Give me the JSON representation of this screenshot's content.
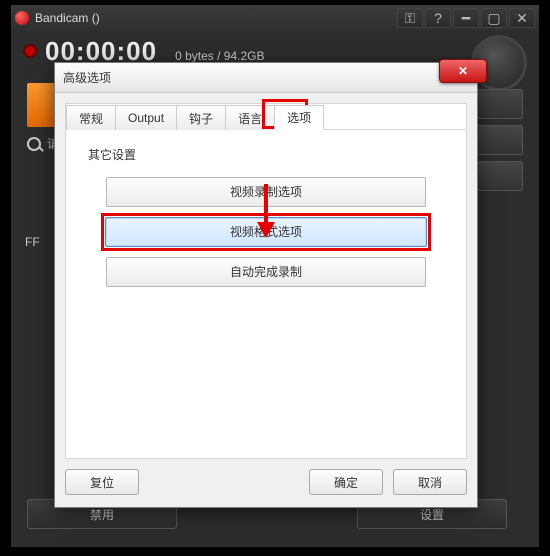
{
  "main": {
    "title": "Bandicam ()",
    "timer": "00:00:00",
    "storage": "0 bytes / 94.2GB",
    "search_prefix": "请",
    "fps_label": "FF",
    "bottom_disable": "禁用",
    "bottom_settings": "设置"
  },
  "dialog": {
    "title": "高级选项",
    "tabs": {
      "general": "常规",
      "output": "Output",
      "hook": "钩子",
      "language": "语言",
      "options": "选项"
    },
    "group_label": "其它设置",
    "buttons": {
      "video_rec_options": "视频录制选项",
      "video_format_options": "视频格式选项",
      "auto_complete_rec": "自动完成录制"
    },
    "footer": {
      "reset": "复位",
      "ok": "确定",
      "cancel": "取消"
    }
  }
}
